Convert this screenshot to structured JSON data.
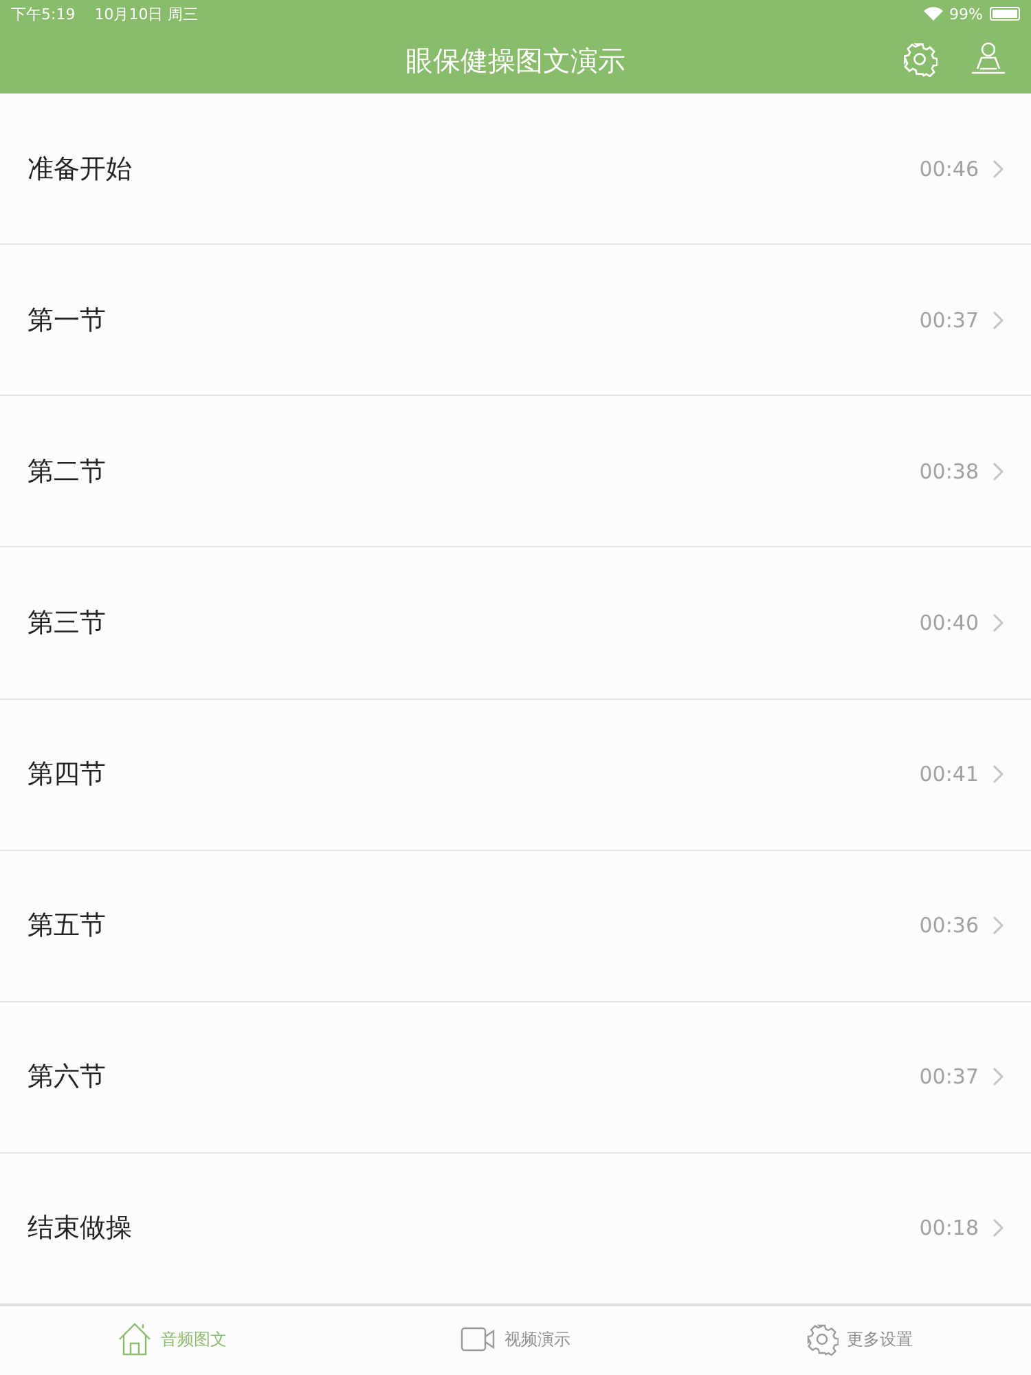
{
  "status_bar": {
    "time": "下午5:19",
    "date": "10月10日 周三",
    "battery": "99%"
  },
  "nav_bar": {
    "title": "眼保健操图文演示"
  },
  "sections": [
    {
      "title": "准备开始",
      "duration": "00:46"
    },
    {
      "title": "第一节",
      "duration": "00:37"
    },
    {
      "title": "第二节",
      "duration": "00:38"
    },
    {
      "title": "第三节",
      "duration": "00:40"
    },
    {
      "title": "第四节",
      "duration": "00:41"
    },
    {
      "title": "第五节",
      "duration": "00:36"
    },
    {
      "title": "第六节",
      "duration": "00:37"
    },
    {
      "title": "结束做操",
      "duration": "00:18"
    }
  ],
  "tab_bar": [
    {
      "label": "音频图文",
      "kind": "home",
      "selected": true
    },
    {
      "label": "视频演示",
      "kind": "video",
      "selected": false
    },
    {
      "label": "更多设置",
      "kind": "gear",
      "selected": false
    }
  ]
}
